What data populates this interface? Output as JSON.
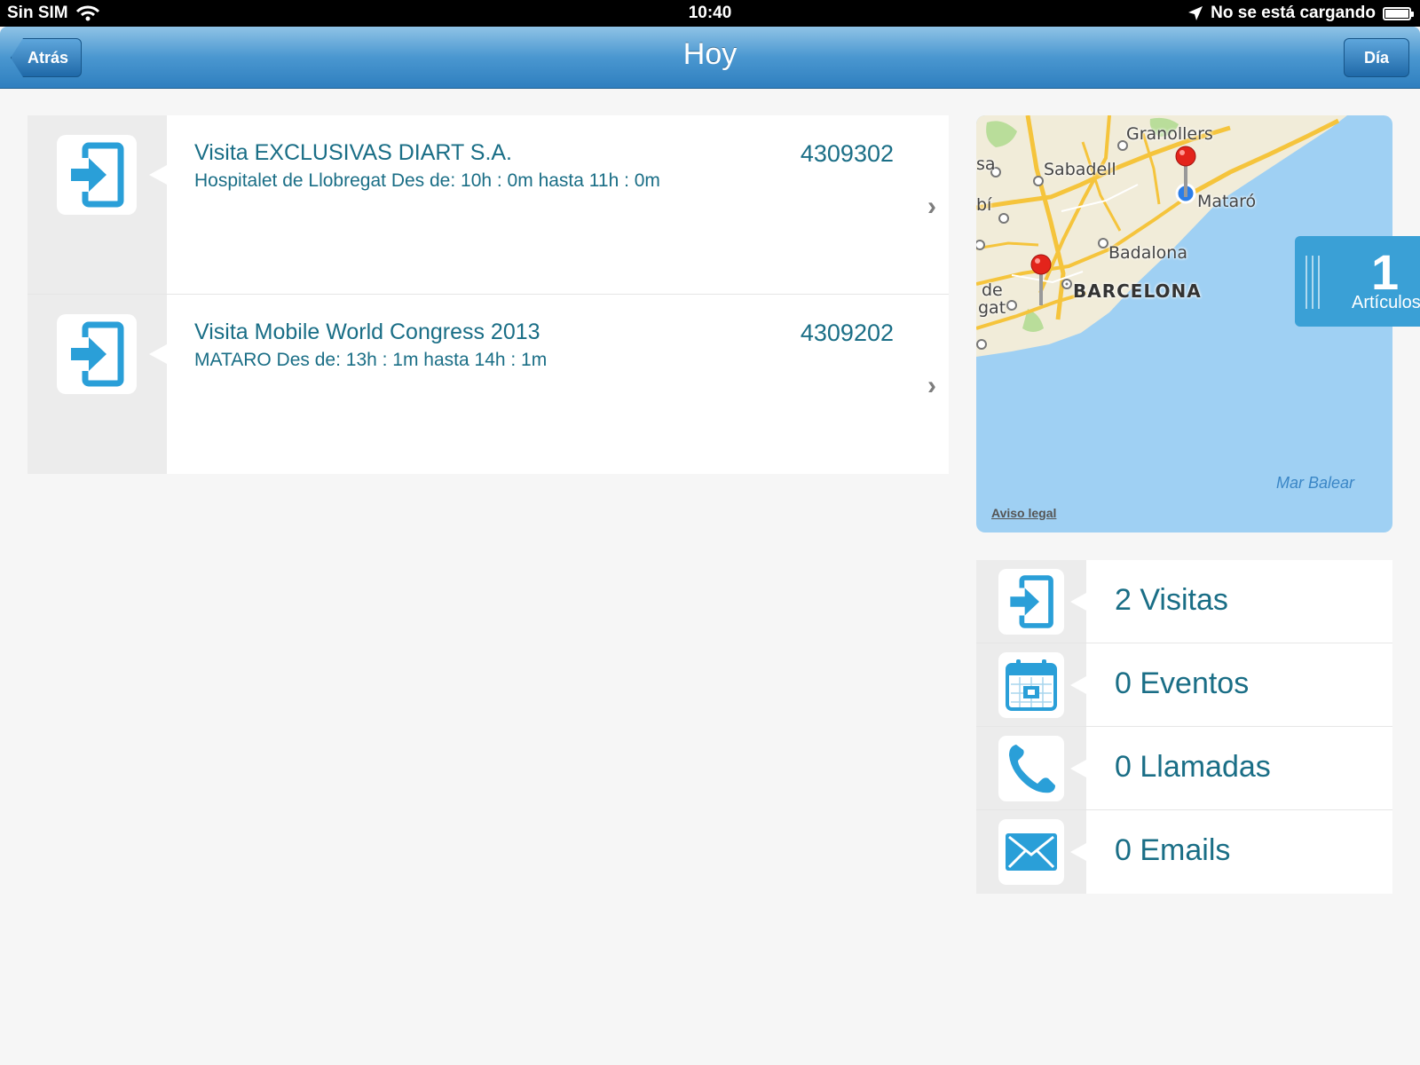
{
  "status_bar": {
    "carrier": "Sin SIM",
    "time": "10:40",
    "charging": "No se está cargando",
    "icons": [
      "wifi-icon",
      "location-arrow-icon",
      "battery-icon"
    ]
  },
  "nav": {
    "title": "Hoy",
    "back_label": "Atrás",
    "right_label": "Día"
  },
  "visits": [
    {
      "title": "Visita EXCLUSIVAS DIART S.A.",
      "subtitle": "Hospitalet de Llobregat Des de: 10h : 0m hasta 11h : 0m",
      "code": "4309302",
      "icon": "enter-icon"
    },
    {
      "title": "Visita Mobile World Congress 2013",
      "subtitle": "MATARO Des de: 13h : 1m hasta 14h : 1m",
      "code": "4309202",
      "icon": "enter-icon"
    }
  ],
  "map": {
    "labels": [
      "Granollers",
      "Sabadell",
      "Mataró",
      "Badalona",
      "sa",
      "bí",
      "de",
      "gat"
    ],
    "city": "BARCELONA",
    "sea": "Mar Balear",
    "legal": "Aviso legal"
  },
  "articles": {
    "count": "1",
    "label": "Artículos"
  },
  "summary": [
    {
      "label": "2 Visitas",
      "icon": "enter-icon"
    },
    {
      "label": "0 Eventos",
      "icon": "calendar-icon"
    },
    {
      "label": "0 Llamadas",
      "icon": "phone-icon"
    },
    {
      "label": "0 Emails",
      "icon": "envelope-icon"
    }
  ],
  "colors": {
    "accent": "#2a9fd8",
    "text": "#1a6e86",
    "nav_bar": "#4a97d0",
    "map_sea": "#9fd0f3"
  }
}
